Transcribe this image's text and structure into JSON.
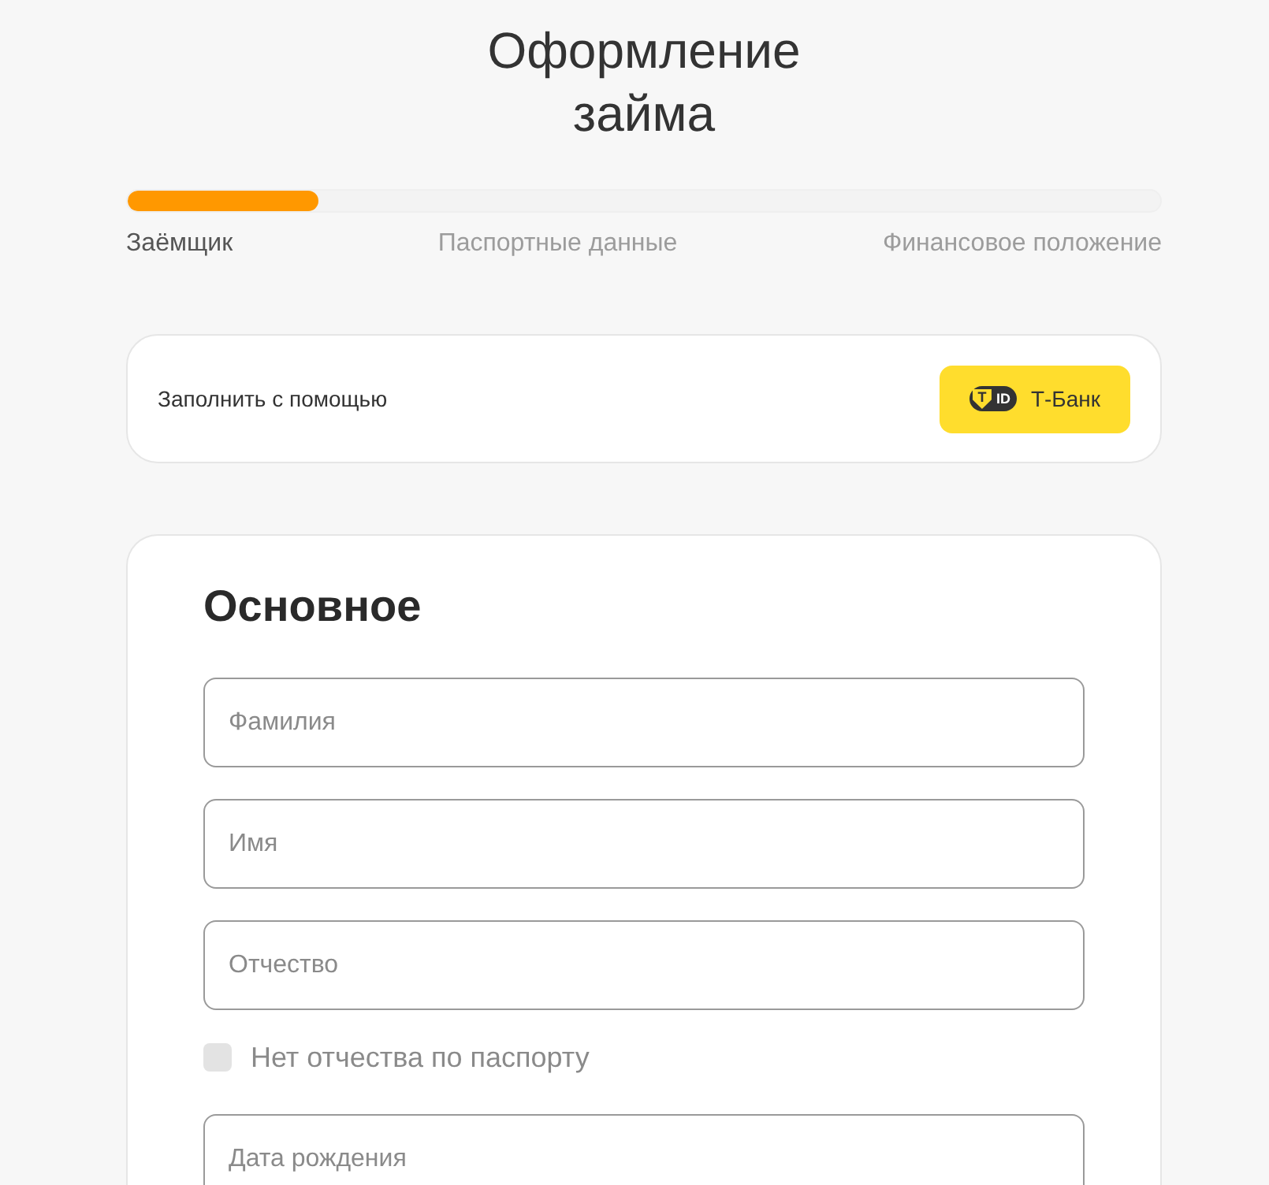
{
  "title": "Оформление займа",
  "progress": {
    "level": 0.185
  },
  "steps": [
    {
      "label": "Заёмщик",
      "current": true
    },
    {
      "label": "Паспортные данные",
      "current": false
    },
    {
      "label": "Финансовое положение",
      "current": false
    }
  ],
  "autofill": {
    "label": "Заполнить с помощью",
    "button": {
      "logo_mark": "Т",
      "logo_text": "ID",
      "label": "Т-Банк"
    }
  },
  "form": {
    "heading": "Основное",
    "fields": [
      {
        "kind": "text",
        "placeholder": "Фамилия"
      },
      {
        "kind": "text",
        "placeholder": "Имя"
      },
      {
        "kind": "text",
        "placeholder": "Отчество"
      },
      {
        "kind": "checkbox",
        "label": "Нет отчества по паспорту",
        "checked": false
      },
      {
        "kind": "text",
        "placeholder": "Дата рождения"
      }
    ]
  }
}
